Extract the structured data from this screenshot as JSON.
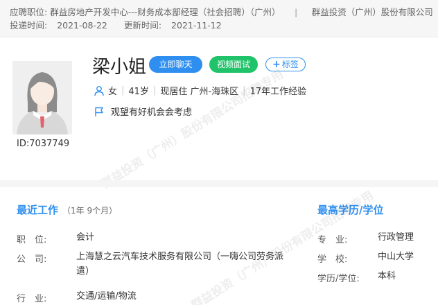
{
  "header": {
    "position_label": "应聘职位:",
    "position_value": "群益房地产开发中心---财务成本部经理（社会招聘）（广州）",
    "company": "群益投资（广州）股份有限公司",
    "delivered_label": "投递时间:",
    "delivered_value": "2021-08-22",
    "updated_label": "更新时间:",
    "updated_value": "2021-11-12"
  },
  "profile": {
    "name": "梁小姐",
    "id_text": "ID:7037749",
    "buttons": {
      "chat": "立即聊天",
      "video": "视频面试",
      "tag": "标签"
    },
    "gender": "女",
    "age": "41岁",
    "residence": "现居住 广州-海珠区",
    "experience": "17年工作经验",
    "status": "观望有好机会会考虑"
  },
  "watermark": "群益投资（广州）股份有限公司招聘专用",
  "recent_work": {
    "title": "最近工作",
    "duration": "（1年 9个月）",
    "position_label": "职　位:",
    "position_value": "会计",
    "company_label": "公　司:",
    "company_value": "上海慧之云汽车技术服务有限公司（一嗨公司劳务派遣）",
    "industry_label": "行　业:",
    "industry_value": "交通/运输/物流"
  },
  "education": {
    "title": "最高学历/学位",
    "major_label": "专　业:",
    "major_value": "行政管理",
    "school_label": "学　校:",
    "school_value": "中山大学",
    "degree_label": "学历/学位:",
    "degree_value": "本科"
  },
  "colors": {
    "accent": "#2e8ff0",
    "video": "#20c36a"
  }
}
